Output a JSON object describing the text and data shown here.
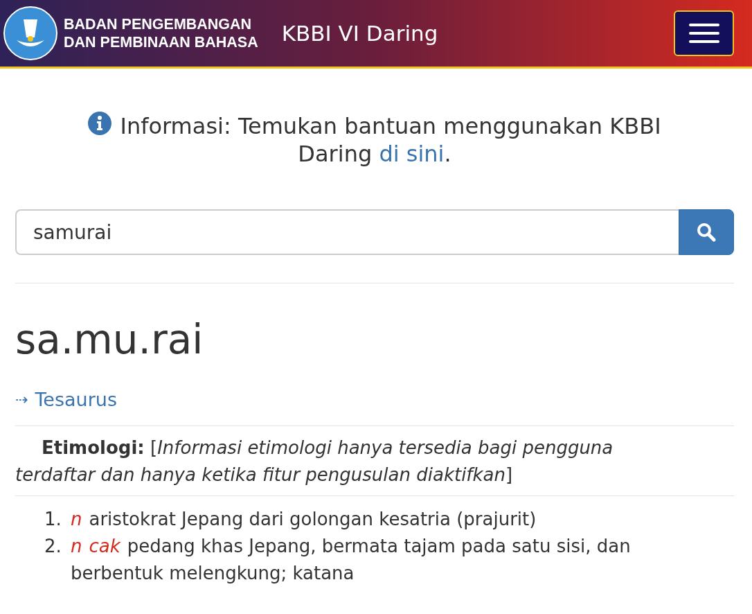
{
  "header": {
    "org_line_1": "BADAN PENGEMBANGAN",
    "org_line_2": "DAN PEMBINAAN BAHASA",
    "title": "KBBI VI Daring"
  },
  "info": {
    "text": "Informasi: Temukan bantuan menggunakan KBBI Daring ",
    "link": "di sini",
    "end": "."
  },
  "search": {
    "value": "samurai"
  },
  "entry": {
    "headword": "sa.mu.rai",
    "thesaurus_arrow": "⇢",
    "thesaurus": "Tesaurus",
    "etymology": "**Etimologi:** [*Informasi etimologi hanya tersedia bagi pengguna terdaftar dan hanya ketika fitur pengusulan diaktifkan*]",
    "definitions": [
      {
        "number": "1.",
        "labels": [
          "n"
        ],
        "text": "aristokrat Jepang dari golongan kesatria (prajurit)"
      },
      {
        "number": "2.",
        "labels": [
          "n",
          "cak"
        ],
        "text": "pedang khas Jepang, bermata tajam pada satu sisi, dan berbentuk melengkung; katana"
      }
    ]
  }
}
